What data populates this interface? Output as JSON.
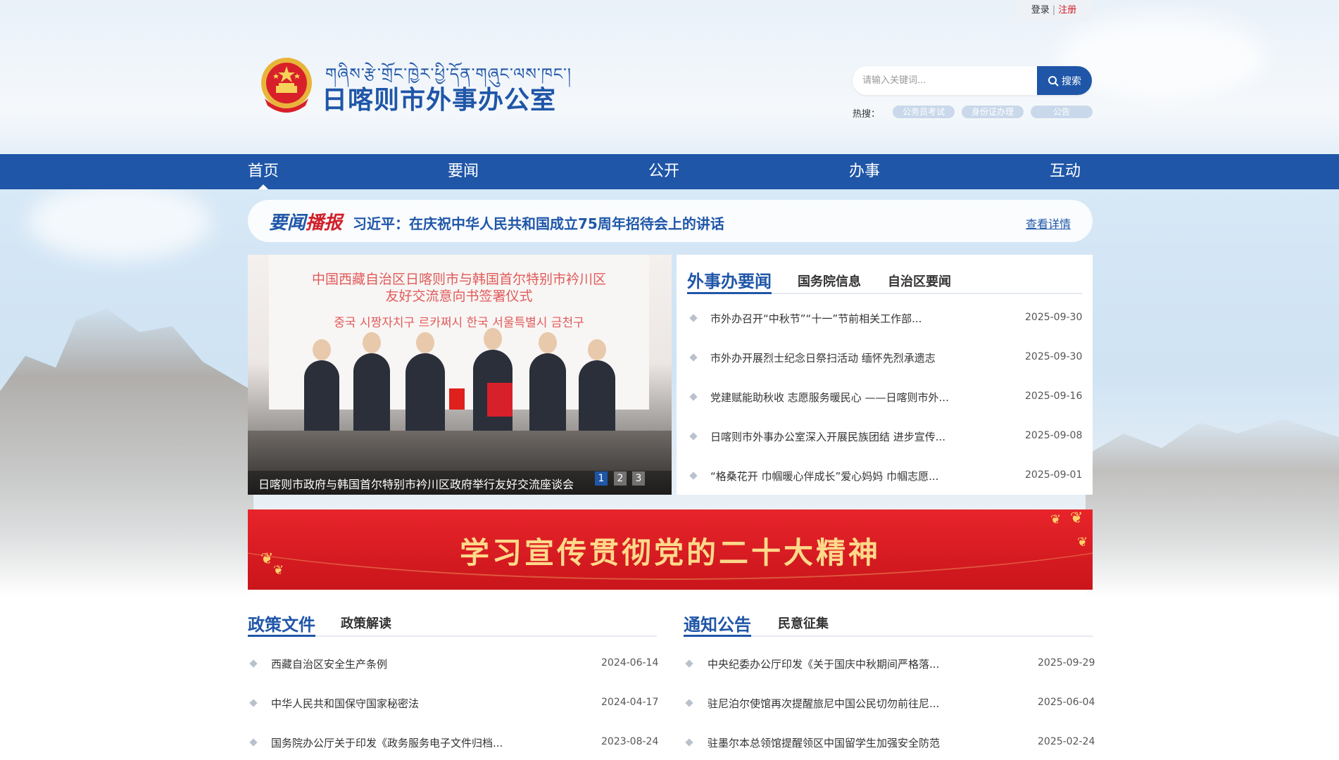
{
  "login": {
    "login_label": "登录",
    "separator": "|",
    "register_label": "注册"
  },
  "header": {
    "tibetan_title": "གཞིས་རྩེ་གྲོང་ཁྱེར་ཕྱི་དོན་གཞུང་ལས་ཁང་།",
    "title": "日喀则市外事办公室"
  },
  "search": {
    "placeholder": "请输入关键词...",
    "button_label": "搜索",
    "hot_label": "热搜：",
    "hot_tags": [
      "公务员考试",
      "身份证办理",
      "公告"
    ]
  },
  "nav": {
    "items": [
      "首页",
      "要闻",
      "公开",
      "办事",
      "互动"
    ]
  },
  "ticker": {
    "badge_part1": "要闻",
    "badge_part2": "播报",
    "headline": "习近平：在庆祝中华人民共和国成立75周年招待会上的讲话",
    "more_label": "查看详情"
  },
  "carousel": {
    "backdrop_lines": [
      "中国西藏自治区日喀则市与韩国首尔特别市衿川区",
      "友好交流意向书签署仪式",
      "중국 시짱자치구 르카쩌시 한국 서울특별시 금천구"
    ],
    "caption": "日喀则市政府与韩国首尔特别市衿川区政府举行友好交流座谈会",
    "dots": [
      "1",
      "2",
      "3"
    ]
  },
  "news": {
    "tabs": [
      "外事办要闻",
      "国务院信息",
      "自治区要闻"
    ],
    "items": [
      {
        "title": "市外办召开“中秋节”“十一”节前相关工作部...",
        "date": "2025-09-30"
      },
      {
        "title": "市外办开展烈士纪念日祭扫活动 缅怀先烈承遗志",
        "date": "2025-09-30"
      },
      {
        "title": "党建赋能助秋收 志愿服务暖民心 ——日喀则市外...",
        "date": "2025-09-16"
      },
      {
        "title": "日喀则市外事办公室深入开展民族团结 进步宣传...",
        "date": "2025-09-08"
      },
      {
        "title": "“格桑花开 巾帼暖心伴成长”爱心妈妈 巾帼志愿...",
        "date": "2025-09-01"
      }
    ]
  },
  "banner": {
    "text": "学习宣传贯彻党的二十大精神"
  },
  "policy": {
    "tabs": [
      "政策文件",
      "政策解读"
    ],
    "items": [
      {
        "title": "西藏自治区安全生产条例",
        "date": "2024-06-14"
      },
      {
        "title": "中华人民共和国保守国家秘密法",
        "date": "2024-04-17"
      },
      {
        "title": "国务院办公厅关于印发《政务服务电子文件归档...",
        "date": "2023-08-24"
      }
    ]
  },
  "notice": {
    "tabs": [
      "通知公告",
      "民意征集"
    ],
    "items": [
      {
        "title": "中央纪委办公厅印发《关于国庆中秋期间严格落...",
        "date": "2025-09-29"
      },
      {
        "title": "驻尼泊尔使馆再次提醒旅尼中国公民切勿前往尼...",
        "date": "2025-06-04"
      },
      {
        "title": "驻墨尔本总领馆提醒领区中国留学生加强安全防范",
        "date": "2025-02-24"
      }
    ]
  },
  "colors": {
    "brand_blue": "#1f56a8",
    "accent_red": "#d0202a",
    "banner_gold": "#ffd98a"
  }
}
